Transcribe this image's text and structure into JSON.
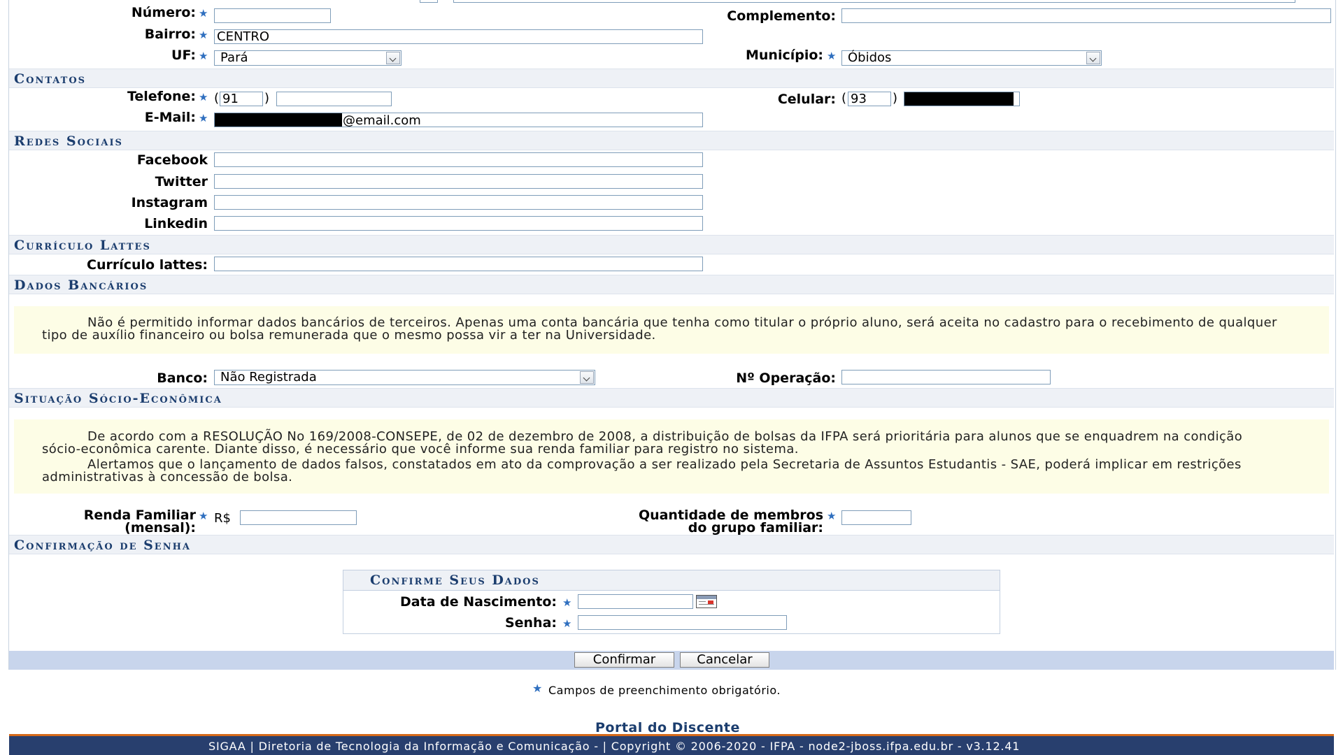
{
  "address": {
    "numero_label": "Número:",
    "numero_value": "",
    "complemento_label": "Complemento:",
    "complemento_value": "",
    "bairro_label": "Bairro:",
    "bairro_value": "CENTRO",
    "uf_label": "UF:",
    "uf_value": "Pará",
    "municipio_label": "Município:",
    "municipio_value": "Óbidos"
  },
  "sections": {
    "contatos": "Contatos",
    "redes_sociais": "Redes Sociais",
    "curriculo_lattes": "Currículo Lattes",
    "dados_bancarios": "Dados Bancários",
    "situacao": "Situação Sócio-Econômica",
    "confirmacao": "Confirmação de Senha"
  },
  "contatos": {
    "telefone_label": "Telefone:",
    "telefone_open": "(",
    "telefone_close": ")",
    "telefone_ddd": "91",
    "telefone_number": "",
    "celular_label": "Celular:",
    "celular_open": "(",
    "celular_close": ")",
    "celular_ddd": "93",
    "email_label": "E-Mail:",
    "email_suffix": "@email.com"
  },
  "redes": {
    "facebook_label": "Facebook",
    "twitter_label": "Twitter",
    "instagram_label": "Instagram",
    "linkedin_label": "Linkedin"
  },
  "lattes": {
    "label": "Currículo lattes:"
  },
  "bancarios": {
    "note": "Não é permitido informar dados bancários de terceiros. Apenas uma conta bancária que tenha como titular o próprio aluno, será aceita no cadastro para o recebimento de qualquer tipo de auxílio financeiro ou bolsa remunerada que o mesmo possa vir a ter na Universidade.",
    "banco_label": "Banco:",
    "banco_value": "Não Registrada",
    "operacao_label": "Nº Operação:"
  },
  "situacao": {
    "note1": "De acordo com a RESOLUÇÃO No 169/2008-CONSEPE, de 02 de dezembro de 2008, a distribuição de bolsas da IFPA será prioritária para alunos que se enquadrem na condição sócio-econômica carente. Diante disso, é necessário que você informe sua renda familiar para registro no sistema.",
    "note2": "Alertamos que o lançamento de dados falsos, constatados em ato da comprovação a ser realizado pela Secretaria de Assuntos Estudantis - SAE, poderá implicar em restrições administrativas à concessão de bolsa.",
    "renda_label_1": "Renda Familiar",
    "renda_label_2": "(mensal):",
    "currency": "R$",
    "membros_label_1": "Quantidade de membros",
    "membros_label_2": "do grupo familiar:"
  },
  "confirm": {
    "title": "Confirme Seus Dados",
    "nascimento_label": "Data de Nascimento:",
    "senha_label": "Senha:",
    "confirmar": "Confirmar",
    "cancelar": "Cancelar"
  },
  "required_note": "Campos de preenchimento obrigatório.",
  "footer": {
    "portal_link": "Portal do Discente",
    "text": "SIGAA | Diretoria de Tecnologia da Informação e Comunicação - | Copyright © 2006-2020 - IFPA - node2-jboss.ifpa.edu.br - v3.12.41"
  },
  "colors": {
    "section_title": "#1b3d6e",
    "section_bg": "#eef1f6",
    "note_bg": "#fdfde6",
    "required_star": "#2f6fbf",
    "footer_bg": "#283f6e",
    "button_bar": "#c8d5ec"
  }
}
